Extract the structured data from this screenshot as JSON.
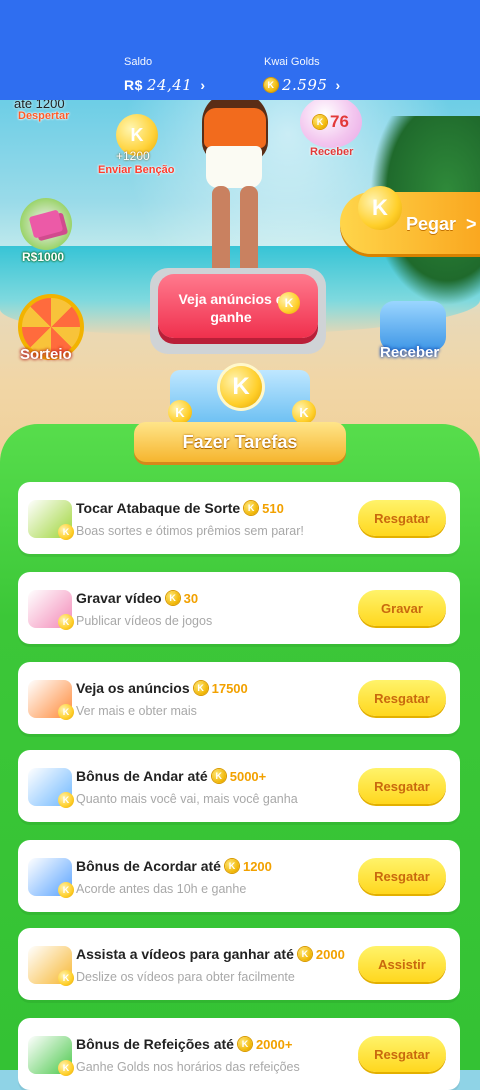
{
  "header": {
    "balance_label": "Saldo",
    "balance_currency": "R$",
    "balance_value": "24,41",
    "golds_label": "Kwai Golds",
    "golds_value": "2.595",
    "chevron": "›",
    "bg_color": "#2f6ef0"
  },
  "scene": {
    "wake_value": "até 1200",
    "wake_label": "Despertar",
    "bless_value": "+1200",
    "bless_label": "Enviar Benção",
    "bubble_value": "76",
    "bubble_label": "Receber",
    "money_label": "R$1000",
    "pegar_label": "Pegar",
    "pegar_chevron": ">",
    "wheel_label": "Sorteio",
    "ads_button_label": "Veja anúncios e ganhe",
    "gift_label": "Receber"
  },
  "banner": {
    "coin_letter": "K",
    "title": "Fazer Tarefas"
  },
  "tasks": [
    {
      "title": "Tocar Atabaque de Sorte",
      "reward": "510",
      "subtitle": "Boas sortes e ótimos prêmios sem parar!",
      "button": "Resgatar",
      "icon": "drum-icon",
      "icon_color": "#9fd53a"
    },
    {
      "title": "Gravar vídeo",
      "reward": "30",
      "subtitle": "Publicar vídeos de jogos",
      "button": "Gravar",
      "icon": "video-camera-icon",
      "icon_color": "#f38ab8"
    },
    {
      "title": "Veja os anúncios",
      "reward": "17500",
      "subtitle": "Ver mais e obter mais",
      "button": "Resgatar",
      "icon": "tv-icon",
      "icon_color": "#ff8a3a"
    },
    {
      "title": "Bônus de Andar até",
      "reward": "5000+",
      "subtitle": "Quanto mais você vai, mais você ganha",
      "button": "Resgatar",
      "icon": "walking-person-icon",
      "icon_color": "#6fb8ff"
    },
    {
      "title": "Bônus de Acordar até",
      "reward": "1200",
      "subtitle": "Acorde antes das 10h e ganhe",
      "button": "Resgatar",
      "icon": "moon-icon",
      "icon_color": "#5aa3ff"
    },
    {
      "title": "Assista a vídeos para ganhar até",
      "reward": "2000",
      "subtitle": "Deslize os vídeos para obter facilmente",
      "button": "Assistir",
      "icon": "movie-camera-icon",
      "icon_color": "#f7b733"
    },
    {
      "title": "Bônus de Refeições até",
      "reward": "2000+",
      "subtitle": "Ganhe Golds nos horários das refeições",
      "button": "Resgatar",
      "icon": "lunchbox-icon",
      "icon_color": "#4cc84c"
    }
  ],
  "coin_letter": "K"
}
